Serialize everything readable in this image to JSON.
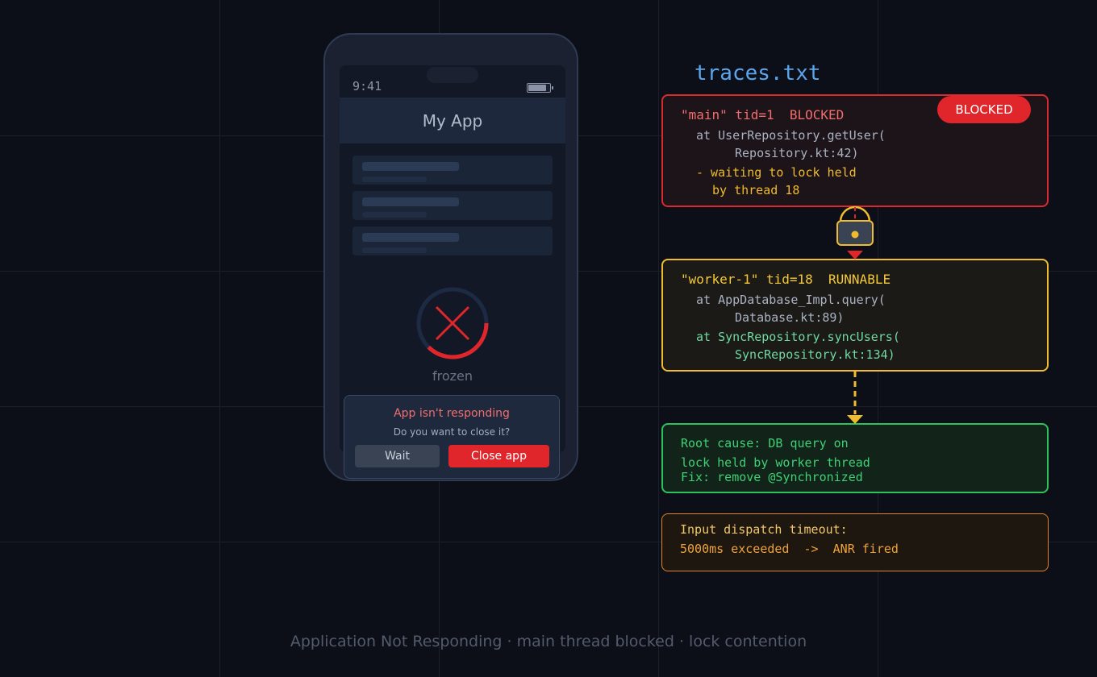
{
  "phone": {
    "status_time": "9:41",
    "app_title": "My App",
    "frozen_label": "frozen",
    "dialog": {
      "title": "App isn't responding",
      "subtitle": "Do you want to close it?",
      "wait_label": "Wait",
      "close_label": "Close app"
    }
  },
  "trace": {
    "file_name": "traces.txt",
    "main_thread": {
      "header": "\"main\" tid=1  BLOCKED",
      "badge": "BLOCKED",
      "line1": "at UserRepository.getUser(",
      "line2": "Repository.kt:42)",
      "wait1": "- waiting to lock held",
      "wait2": "by thread 18"
    },
    "worker_thread": {
      "header": "\"worker-1\" tid=18  RUNNABLE",
      "line1": "at AppDatabase_Impl.query(",
      "line2": "Database.kt:89)",
      "line3": "at SyncRepository.syncUsers(",
      "line4": "SyncRepository.kt:134)"
    },
    "root_cause": {
      "line1": "Root cause: DB query on",
      "line2": "lock held by worker thread",
      "line3": "Fix: remove @Synchronized"
    },
    "timeout": {
      "line1": "Input dispatch timeout:",
      "line2": "5000ms exceeded  ->  ANR fired"
    }
  },
  "footer": "Application Not Responding  ·  main thread blocked  ·  lock contention",
  "colors": {
    "background": "#0c0f17",
    "blocked_red": "#e0262b",
    "runnable_yellow": "#f0bb2c",
    "root_green": "#2cc25e",
    "timeout_orange": "#e08428",
    "title_blue": "#5aa6ef"
  }
}
